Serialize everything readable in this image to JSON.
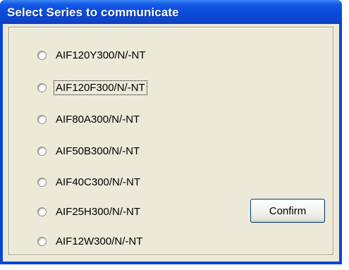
{
  "window": {
    "title": "Select Series to communicate"
  },
  "series_options": [
    {
      "label": "AIF120Y300/N/-NT",
      "selected": false,
      "focused": false
    },
    {
      "label": "AIF120F300/N/-NT",
      "selected": false,
      "focused": true
    },
    {
      "label": "AIF80A300/N/-NT",
      "selected": false,
      "focused": false
    },
    {
      "label": "AIF50B300/N/-NT",
      "selected": false,
      "focused": false
    },
    {
      "label": "AIF40C300/N/-NT",
      "selected": false,
      "focused": false
    },
    {
      "label": "AIF25H300/N/-NT",
      "selected": false,
      "focused": false
    },
    {
      "label": "AIF12W300/N/-NT",
      "selected": false,
      "focused": false
    }
  ],
  "confirm_button": {
    "label": "Confirm"
  },
  "colors": {
    "titlebar": "#0a4ad8",
    "dialog_face": "#ece9d8",
    "button_border": "#003c74"
  }
}
